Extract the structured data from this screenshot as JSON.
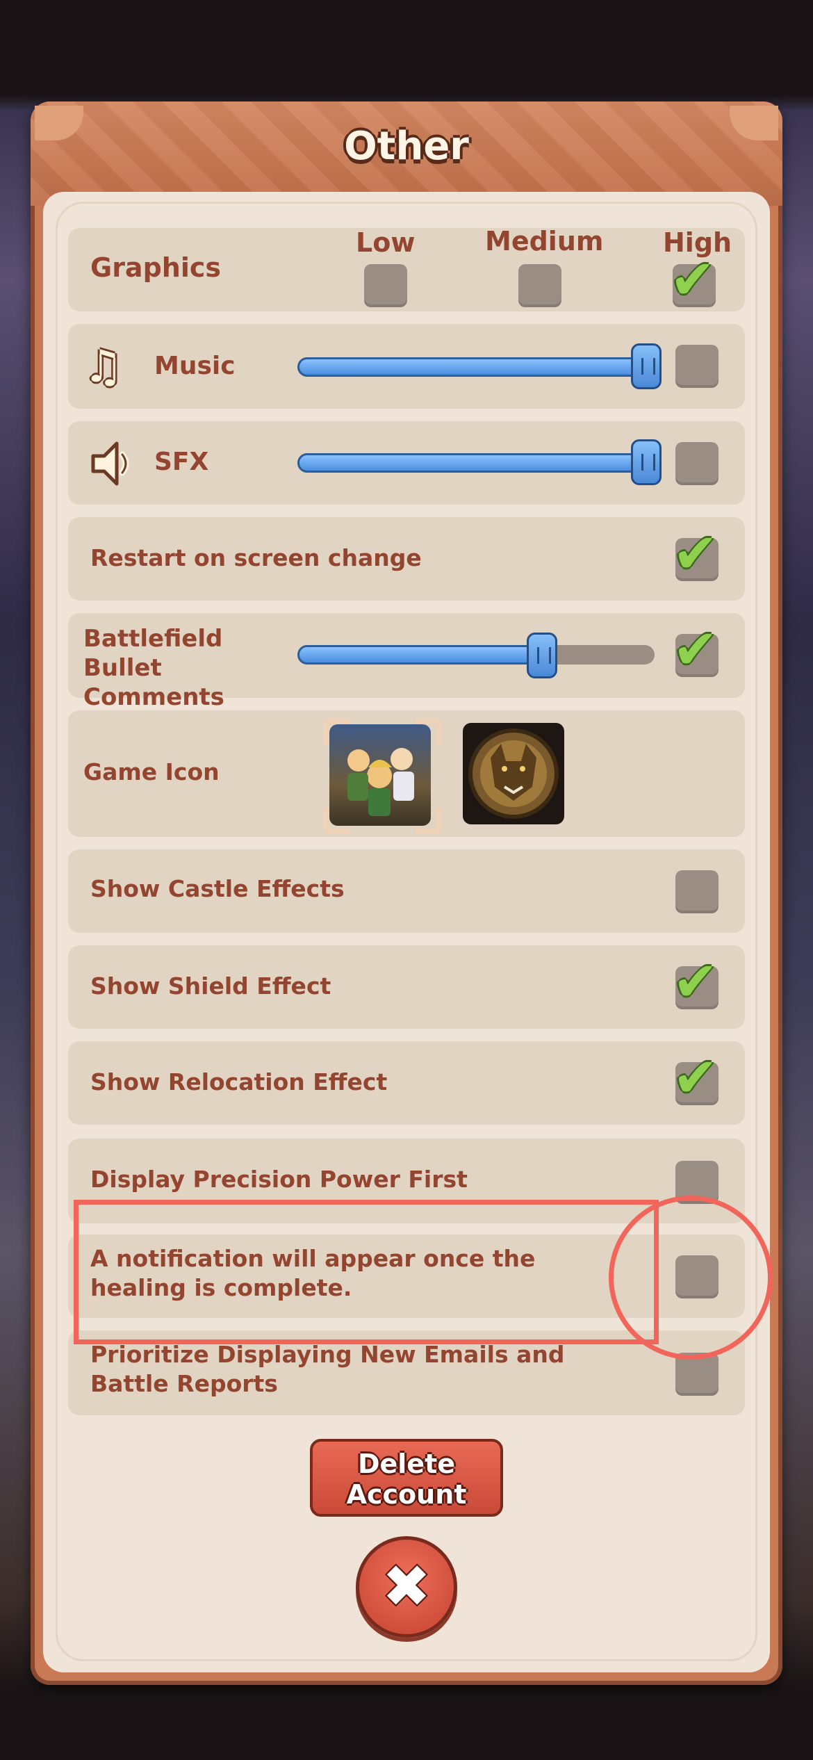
{
  "title": "Other",
  "graphics": {
    "label": "Graphics",
    "options": [
      "Low",
      "Medium",
      "High"
    ],
    "selected": "High"
  },
  "music": {
    "label": "Music",
    "level": 1.0,
    "muted": false
  },
  "sfx": {
    "label": "SFX",
    "level": 1.0,
    "muted": false
  },
  "settings": {
    "restart_on_screen_change": {
      "label": "Restart on screen change",
      "checked": true
    },
    "battlefield_bullet_comments": {
      "label": "Battlefield Bullet Comments",
      "level": 0.67,
      "checked": true
    },
    "game_icon": {
      "label": "Game Icon",
      "selected": "heroes-icon",
      "options": [
        "heroes-icon",
        "wolf-icon"
      ]
    },
    "show_castle_effects": {
      "label": "Show Castle Effects",
      "checked": false
    },
    "show_shield_effect": {
      "label": "Show Shield Effect",
      "checked": true
    },
    "show_relocation_effect": {
      "label": "Show Relocation Effect",
      "checked": true
    },
    "display_precision_power_first": {
      "label": "Display Precision Power First",
      "checked": false
    },
    "healing_notification": {
      "label": "A notification will appear once the healing is complete.",
      "checked": false
    },
    "prioritize_new_emails": {
      "label": "Prioritize Displaying New Emails and Battle Reports",
      "checked": false
    }
  },
  "buttons": {
    "delete_account": "Delete Account",
    "close": "✖"
  },
  "icons": {
    "music": "music-note-icon",
    "sfx": "speaker-icon",
    "check": "checkmark-icon"
  },
  "highlight_color": "#f2655a"
}
